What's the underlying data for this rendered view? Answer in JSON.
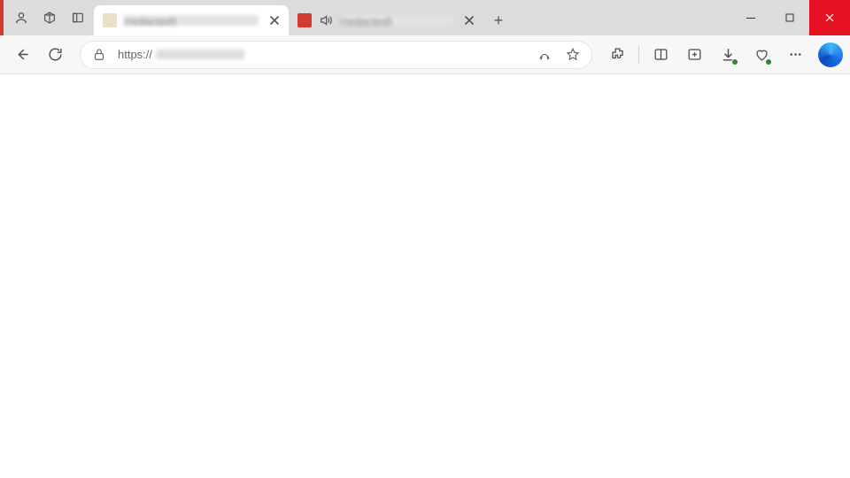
{
  "window": {
    "minimize": "–",
    "maximize": "☐",
    "close": "✕"
  },
  "tabs": [
    {
      "title": "(redacted)",
      "favicon_color": "#e9e0c6",
      "active": true,
      "audio": false
    },
    {
      "title": "(redacted)",
      "favicon_color": "#d23b2f",
      "active": false,
      "audio": true
    }
  ],
  "newtab_label": "+",
  "address_bar": {
    "scheme": "https://",
    "host_redacted": true,
    "value": "https://"
  },
  "toolbar_tooltips": {
    "back": "Back",
    "refresh": "Refresh",
    "site_info": "View site information",
    "read_aloud": "Read aloud",
    "favorite": "Add to favorites",
    "extensions": "Extensions",
    "split": "Split screen",
    "collections": "Collections",
    "downloads": "Downloads",
    "performance": "Browser essentials",
    "more": "Settings and more",
    "copilot": "Copilot"
  },
  "titlebar_tooltips": {
    "profile": "Profile",
    "workspaces": "Workspaces",
    "tab_actions": "Tab actions"
  }
}
